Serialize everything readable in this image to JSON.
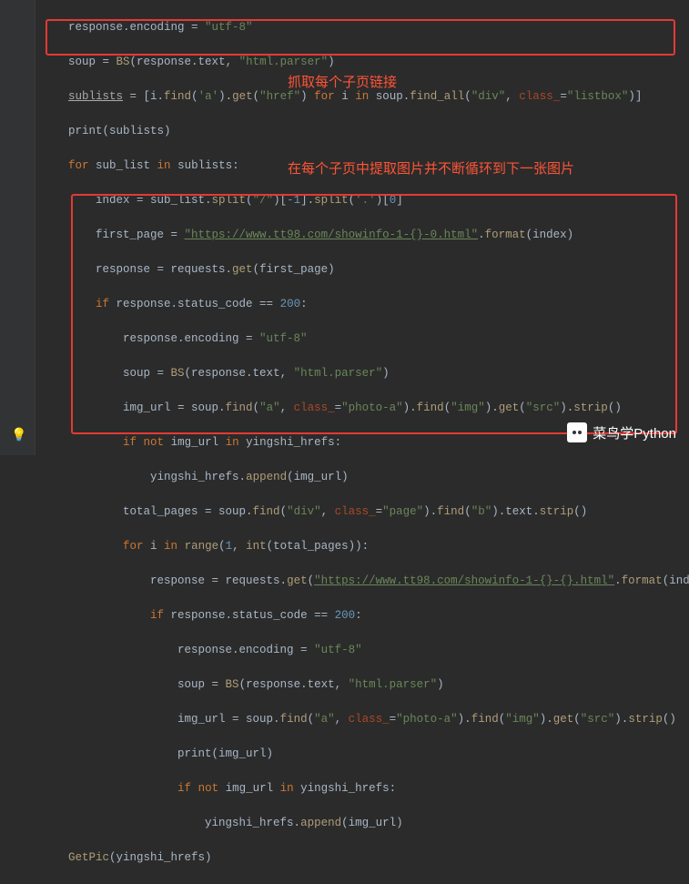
{
  "annotations": {
    "a1": "抓取每个子页链接",
    "a2": "在每个子页中提取图片并不断循环到下一张图片"
  },
  "watermark": "菜鸟学Python",
  "code": {
    "l1": {
      "a": "response.encoding = ",
      "s": "\"utf-8\""
    },
    "l2": {
      "a": "soup = ",
      "b": "BS",
      "c": "(response.text, ",
      "s": "\"html.parser\"",
      "d": ")"
    },
    "l3": {
      "a": "sublists",
      "b": " = [i.",
      "c": "find",
      "d": "(",
      "s1": "'a'",
      "e": ").",
      "f": "get",
      "g": "(",
      "s2": "\"href\"",
      "h": ") ",
      "kw": "for",
      "i": " i ",
      "kw2": "in",
      "j": " soup.",
      "k": "find_all",
      "l": "(",
      "s3": "\"div\"",
      "m": ", ",
      "p": "class_",
      "n": "=",
      "s4": "\"listbox\"",
      "o": ")]"
    },
    "l4": {
      "a": "print(sublists)"
    },
    "l5": {
      "kw": "for",
      "a": " sub_list ",
      "kw2": "in",
      "b": " sublists:"
    },
    "l6": {
      "a": "index = sub_list.",
      "b": "split",
      "c": "(",
      "s1": "\"/\"",
      "d": ")[",
      "n1": "-1",
      "e": "].",
      "f": "split",
      "g": "(",
      "s2": "'.'",
      "h": ")[",
      "n2": "0",
      "i": "]"
    },
    "l7": {
      "a": "first_page = ",
      "s": "\"https://www.tt98.com/showinfo-1-{}-0.html\"",
      "b": ".",
      "c": "format",
      "d": "(index)"
    },
    "l8": {
      "a": "response = requests.",
      "b": "get",
      "c": "(first_page)"
    },
    "l9": {
      "kw": "if",
      "a": " response.status_code == ",
      "n": "200",
      "b": ":"
    },
    "l10": {
      "a": "response.encoding = ",
      "s": "\"utf-8\""
    },
    "l11": {
      "a": "soup = ",
      "b": "BS",
      "c": "(response.text, ",
      "s": "\"html.parser\"",
      "d": ")"
    },
    "l12": {
      "a": "img_url = soup.",
      "b": "find",
      "c": "(",
      "s1": "\"a\"",
      "d": ", ",
      "p": "class_",
      "e": "=",
      "s2": "\"photo-a\"",
      "f": ").",
      "g": "find",
      "h": "(",
      "s3": "\"img\"",
      "i": ").",
      "j": "get",
      "k": "(",
      "s4": "\"src\"",
      "l": ").",
      "m": "strip",
      "n": "()"
    },
    "l13": {
      "kw": "if",
      "a": " ",
      "kw2": "not",
      "b": " img_url ",
      "kw3": "in",
      "c": " yingshi_hrefs:"
    },
    "l14": {
      "a": "yingshi_hrefs.",
      "b": "append",
      "c": "(img_url)"
    },
    "l15": {
      "a": "total_pages = soup.",
      "b": "find",
      "c": "(",
      "s1": "\"div\"",
      "d": ", ",
      "p": "class_",
      "e": "=",
      "s2": "\"page\"",
      "f": ").",
      "g": "find",
      "h": "(",
      "s3": "\"b\"",
      "i": ").text.",
      "j": "strip",
      "k": "()"
    },
    "l16": {
      "kw": "for",
      "a": " i ",
      "kw2": "in",
      "b": " ",
      "c": "range",
      "d": "(",
      "n1": "1",
      "e": ", ",
      "f": "int",
      "g": "(total_pages)):"
    },
    "l17": {
      "a": "response = requests.",
      "b": "get",
      "c": "(",
      "s": "\"https://www.tt98.com/showinfo-1-{}-{}.html\"",
      "d": ".",
      "e": "format",
      "f": "(index, i))"
    },
    "l18": {
      "kw": "if",
      "a": " response.status_code == ",
      "n": "200",
      "b": ":"
    },
    "l19": {
      "a": "response.encoding = ",
      "s": "\"utf-8\""
    },
    "l20": {
      "a": "soup = ",
      "b": "BS",
      "c": "(response.text, ",
      "s": "\"html.parser\"",
      "d": ")"
    },
    "l21": {
      "a": "img_url = soup.",
      "b": "find",
      "c": "(",
      "s1": "\"a\"",
      "d": ", ",
      "p": "class_",
      "e": "=",
      "s2": "\"photo-a\"",
      "f": ").",
      "g": "find",
      "h": "(",
      "s3": "\"img\"",
      "i": ").",
      "j": "get",
      "k": "(",
      "s4": "\"src\"",
      "l": ").",
      "m": "strip",
      "n": "()"
    },
    "l22": {
      "a": "print(img_url)"
    },
    "l23": {
      "kw": "if",
      "a": " ",
      "kw2": "not",
      "b": " img_url ",
      "kw3": "in",
      "c": " yingshi_hrefs:"
    },
    "l24": {
      "a": "yingshi_hrefs.",
      "b": "append",
      "c": "(img_url)"
    },
    "l25": {
      "a": "GetPic",
      "b": "(yingshi_hrefs)"
    }
  }
}
